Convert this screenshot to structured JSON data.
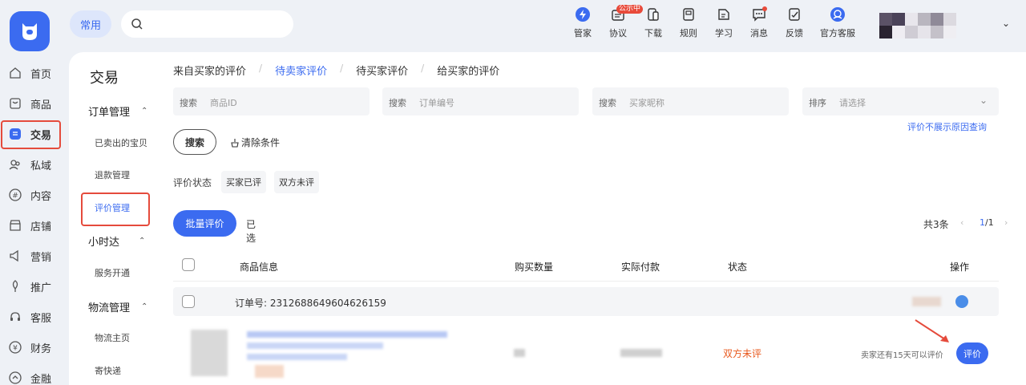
{
  "top": {
    "quick_tag": "常用",
    "search_placeholder": "",
    "tools": [
      {
        "label": "管家",
        "icon": "lightning-icon"
      },
      {
        "label": "协议",
        "icon": "agreement-icon",
        "badge": "公示中"
      },
      {
        "label": "下载",
        "icon": "download-icon"
      },
      {
        "label": "规则",
        "icon": "rules-icon"
      },
      {
        "label": "学习",
        "icon": "learn-icon"
      },
      {
        "label": "消息",
        "icon": "message-icon"
      },
      {
        "label": "反馈",
        "icon": "feedback-icon"
      },
      {
        "label": "官方客服",
        "icon": "service-icon"
      }
    ]
  },
  "leftnav": {
    "items": [
      {
        "label": "首页",
        "icon": "home-icon"
      },
      {
        "label": "商品",
        "icon": "goods-icon"
      },
      {
        "label": "交易",
        "icon": "trade-icon"
      },
      {
        "label": "私域",
        "icon": "private-icon"
      },
      {
        "label": "内容",
        "icon": "content-icon"
      },
      {
        "label": "店铺",
        "icon": "shop-icon"
      },
      {
        "label": "营销",
        "icon": "marketing-icon"
      },
      {
        "label": "推广",
        "icon": "promote-icon"
      },
      {
        "label": "客服",
        "icon": "headset-icon"
      },
      {
        "label": "财务",
        "icon": "finance-icon"
      },
      {
        "label": "金融",
        "icon": "loan-icon"
      }
    ]
  },
  "subnav": {
    "title": "交易",
    "groups": [
      {
        "label": "订单管理",
        "items": [
          "已卖出的宝贝",
          "退款管理",
          "评价管理"
        ]
      },
      {
        "label": "小时达",
        "items": [
          "服务开通"
        ]
      },
      {
        "label": "物流管理",
        "items": [
          "物流主页",
          "寄快递"
        ]
      }
    ]
  },
  "tabs": [
    "来自买家的评价",
    "待卖家评价",
    "待买家评价",
    "给买家的评价"
  ],
  "filters": [
    {
      "label": "搜索",
      "placeholder": "商品ID"
    },
    {
      "label": "搜索",
      "placeholder": "订单编号"
    },
    {
      "label": "搜索",
      "placeholder": "买家昵称"
    },
    {
      "label": "排序",
      "placeholder": "请选择"
    }
  ],
  "reason_link": "评价不展示原因查询",
  "search_button": "搜索",
  "clear_button": "清除条件",
  "status_label": "评价状态",
  "status_chips": [
    "买家已评",
    "双方未评"
  ],
  "batch_button": "批量评价",
  "selected_label": "已选",
  "total": "共3条",
  "pager": {
    "prev": "‹",
    "current": "1",
    "sep": "/1",
    "next": "›"
  },
  "table": {
    "headers": [
      "商品信息",
      "购买数量",
      "实际付款",
      "状态",
      "操作"
    ],
    "order_no": "订单号: 2312688649604626159",
    "row_status": "双方未评",
    "days_left": "卖家还有15天可以评价",
    "rate_button": "评价"
  },
  "colors": {
    "accent": "#3b6bf0",
    "warn": "#e8591e",
    "highlight_box": "#e54b3c"
  }
}
